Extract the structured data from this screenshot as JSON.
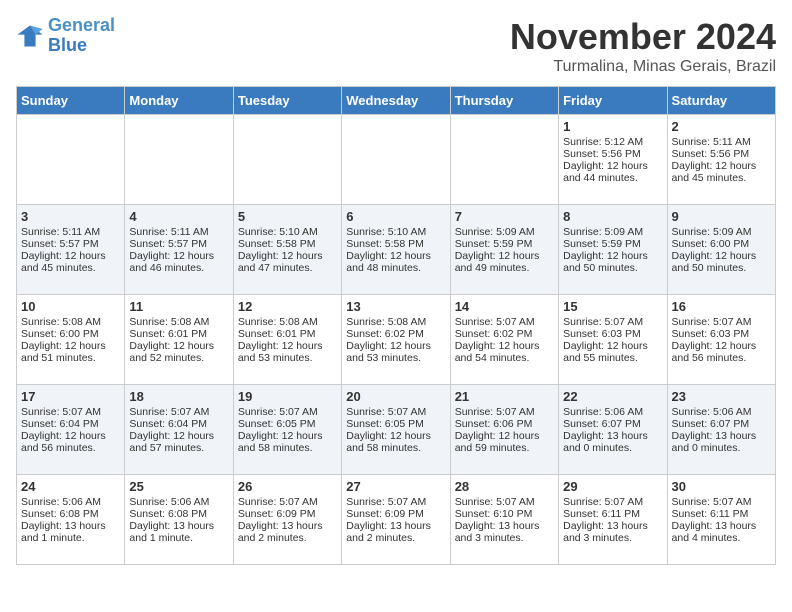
{
  "logo": {
    "line1": "General",
    "line2": "Blue"
  },
  "title": "November 2024",
  "location": "Turmalina, Minas Gerais, Brazil",
  "headers": [
    "Sunday",
    "Monday",
    "Tuesday",
    "Wednesday",
    "Thursday",
    "Friday",
    "Saturday"
  ],
  "weeks": [
    [
      {
        "day": "",
        "info": ""
      },
      {
        "day": "",
        "info": ""
      },
      {
        "day": "",
        "info": ""
      },
      {
        "day": "",
        "info": ""
      },
      {
        "day": "",
        "info": ""
      },
      {
        "day": "1",
        "info": "Sunrise: 5:12 AM\nSunset: 5:56 PM\nDaylight: 12 hours\nand 44 minutes."
      },
      {
        "day": "2",
        "info": "Sunrise: 5:11 AM\nSunset: 5:56 PM\nDaylight: 12 hours\nand 45 minutes."
      }
    ],
    [
      {
        "day": "3",
        "info": "Sunrise: 5:11 AM\nSunset: 5:57 PM\nDaylight: 12 hours\nand 45 minutes."
      },
      {
        "day": "4",
        "info": "Sunrise: 5:11 AM\nSunset: 5:57 PM\nDaylight: 12 hours\nand 46 minutes."
      },
      {
        "day": "5",
        "info": "Sunrise: 5:10 AM\nSunset: 5:58 PM\nDaylight: 12 hours\nand 47 minutes."
      },
      {
        "day": "6",
        "info": "Sunrise: 5:10 AM\nSunset: 5:58 PM\nDaylight: 12 hours\nand 48 minutes."
      },
      {
        "day": "7",
        "info": "Sunrise: 5:09 AM\nSunset: 5:59 PM\nDaylight: 12 hours\nand 49 minutes."
      },
      {
        "day": "8",
        "info": "Sunrise: 5:09 AM\nSunset: 5:59 PM\nDaylight: 12 hours\nand 50 minutes."
      },
      {
        "day": "9",
        "info": "Sunrise: 5:09 AM\nSunset: 6:00 PM\nDaylight: 12 hours\nand 50 minutes."
      }
    ],
    [
      {
        "day": "10",
        "info": "Sunrise: 5:08 AM\nSunset: 6:00 PM\nDaylight: 12 hours\nand 51 minutes."
      },
      {
        "day": "11",
        "info": "Sunrise: 5:08 AM\nSunset: 6:01 PM\nDaylight: 12 hours\nand 52 minutes."
      },
      {
        "day": "12",
        "info": "Sunrise: 5:08 AM\nSunset: 6:01 PM\nDaylight: 12 hours\nand 53 minutes."
      },
      {
        "day": "13",
        "info": "Sunrise: 5:08 AM\nSunset: 6:02 PM\nDaylight: 12 hours\nand 53 minutes."
      },
      {
        "day": "14",
        "info": "Sunrise: 5:07 AM\nSunset: 6:02 PM\nDaylight: 12 hours\nand 54 minutes."
      },
      {
        "day": "15",
        "info": "Sunrise: 5:07 AM\nSunset: 6:03 PM\nDaylight: 12 hours\nand 55 minutes."
      },
      {
        "day": "16",
        "info": "Sunrise: 5:07 AM\nSunset: 6:03 PM\nDaylight: 12 hours\nand 56 minutes."
      }
    ],
    [
      {
        "day": "17",
        "info": "Sunrise: 5:07 AM\nSunset: 6:04 PM\nDaylight: 12 hours\nand 56 minutes."
      },
      {
        "day": "18",
        "info": "Sunrise: 5:07 AM\nSunset: 6:04 PM\nDaylight: 12 hours\nand 57 minutes."
      },
      {
        "day": "19",
        "info": "Sunrise: 5:07 AM\nSunset: 6:05 PM\nDaylight: 12 hours\nand 58 minutes."
      },
      {
        "day": "20",
        "info": "Sunrise: 5:07 AM\nSunset: 6:05 PM\nDaylight: 12 hours\nand 58 minutes."
      },
      {
        "day": "21",
        "info": "Sunrise: 5:07 AM\nSunset: 6:06 PM\nDaylight: 12 hours\nand 59 minutes."
      },
      {
        "day": "22",
        "info": "Sunrise: 5:06 AM\nSunset: 6:07 PM\nDaylight: 13 hours\nand 0 minutes."
      },
      {
        "day": "23",
        "info": "Sunrise: 5:06 AM\nSunset: 6:07 PM\nDaylight: 13 hours\nand 0 minutes."
      }
    ],
    [
      {
        "day": "24",
        "info": "Sunrise: 5:06 AM\nSunset: 6:08 PM\nDaylight: 13 hours\nand 1 minute."
      },
      {
        "day": "25",
        "info": "Sunrise: 5:06 AM\nSunset: 6:08 PM\nDaylight: 13 hours\nand 1 minute."
      },
      {
        "day": "26",
        "info": "Sunrise: 5:07 AM\nSunset: 6:09 PM\nDaylight: 13 hours\nand 2 minutes."
      },
      {
        "day": "27",
        "info": "Sunrise: 5:07 AM\nSunset: 6:09 PM\nDaylight: 13 hours\nand 2 minutes."
      },
      {
        "day": "28",
        "info": "Sunrise: 5:07 AM\nSunset: 6:10 PM\nDaylight: 13 hours\nand 3 minutes."
      },
      {
        "day": "29",
        "info": "Sunrise: 5:07 AM\nSunset: 6:11 PM\nDaylight: 13 hours\nand 3 minutes."
      },
      {
        "day": "30",
        "info": "Sunrise: 5:07 AM\nSunset: 6:11 PM\nDaylight: 13 hours\nand 4 minutes."
      }
    ]
  ]
}
